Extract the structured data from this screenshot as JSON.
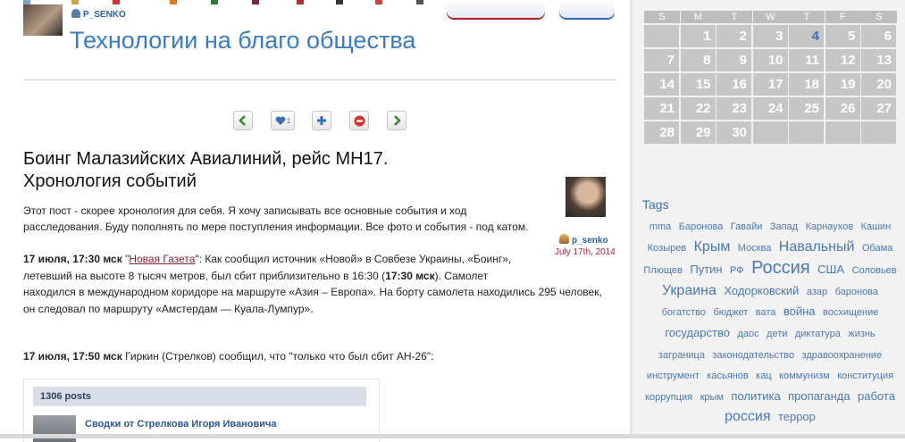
{
  "header": {
    "author": "p_senko",
    "site_title": "Технологии на благо общества"
  },
  "nav": {
    "prev_icon": "chevron-left-icon",
    "like_icon": "heart-icon",
    "like_count": "1",
    "add_icon": "plus-icon",
    "block_icon": "no-entry-icon",
    "next_icon": "chevron-right-icon"
  },
  "post": {
    "title_line1": "Боинг Малазийских Авиалиний, рейс MH17.",
    "title_line2": "Хронология событий",
    "intro_line1": "Этот пост - скорее хронология для себя. Я хочу записывать все основные события и ход",
    "intro_line2": "расследования. Буду пополнять по мере поступления информации. Все фото и события - под катом.",
    "author": "p_senko",
    "date": "July 17th, 2014",
    "entry1": {
      "time": "17 июля, 17:30 мск",
      "q_open": " \"",
      "source": "Новая Газета",
      "line1_rest": "\": Как сообщил источник «Новой» в Совбезе Украины, «Боинг»,",
      "line2_pre": "летевший на высоте 8 тысяч метров, был сбит приблизительно в 16:30 (",
      "line2_bold": "17:30 мск",
      "line2_post": "). Самолет",
      "line3": "находился в международном коридоре на маршруте «Азия – Европа». На борту самолета находились 295 человек,",
      "line4": "он следовал по маршруту «Амстердам — Куала-Лумпур»."
    },
    "entry2": {
      "time": "17 июля, 17:50 мск",
      "text": " Гиркин (Стрелков) сообщил, что \"только что был сбит АН-26\":"
    },
    "embed": {
      "posts": "1306 posts",
      "link": "Сводки от Стрелкова Игоря Ивановича"
    }
  },
  "calendar": {
    "weekdays": [
      "S",
      "M",
      "T",
      "W",
      "T",
      "F",
      "S"
    ],
    "weeks": [
      [
        "",
        "1",
        "2",
        "3",
        "4",
        "5",
        "6"
      ],
      [
        "7",
        "8",
        "9",
        "10",
        "11",
        "12",
        "13"
      ],
      [
        "14",
        "15",
        "16",
        "17",
        "18",
        "19",
        "20"
      ],
      [
        "21",
        "22",
        "23",
        "24",
        "25",
        "26",
        "27"
      ],
      [
        "28",
        "29",
        "30",
        "",
        "",
        "",
        ""
      ]
    ],
    "highlighted": "4"
  },
  "tags": {
    "title": "Tags",
    "items": [
      {
        "text": "mma",
        "weight": 1
      },
      {
        "text": "Баронова",
        "weight": 1
      },
      {
        "text": "Гавайи",
        "weight": 1
      },
      {
        "text": "Запад",
        "weight": 1
      },
      {
        "text": "Карнаухов",
        "weight": 1
      },
      {
        "text": "Кашин",
        "weight": 1
      },
      {
        "text": "Козырев",
        "weight": 1
      },
      {
        "text": "Крым",
        "weight": 3
      },
      {
        "text": "Москва",
        "weight": 1
      },
      {
        "text": "Навальный",
        "weight": 3
      },
      {
        "text": "Обама",
        "weight": 1
      },
      {
        "text": "Плющев",
        "weight": 1
      },
      {
        "text": "Путин",
        "weight": 2
      },
      {
        "text": "РФ",
        "weight": 1
      },
      {
        "text": "Россия",
        "weight": 4
      },
      {
        "text": "США",
        "weight": 2
      },
      {
        "text": "Соловьев",
        "weight": 1
      },
      {
        "text": "Украина",
        "weight": 3
      },
      {
        "text": "Ходорковский",
        "weight": 2
      },
      {
        "text": "азар",
        "weight": 1
      },
      {
        "text": "баронова",
        "weight": 1
      },
      {
        "text": "богатство",
        "weight": 1
      },
      {
        "text": "бюджет",
        "weight": 1
      },
      {
        "text": "вата",
        "weight": 1
      },
      {
        "text": "война",
        "weight": 2
      },
      {
        "text": "восхищение",
        "weight": 1
      },
      {
        "text": "государство",
        "weight": 2
      },
      {
        "text": "даос",
        "weight": 1
      },
      {
        "text": "дети",
        "weight": 1
      },
      {
        "text": "диктатура",
        "weight": 1
      },
      {
        "text": "жизнь",
        "weight": 1
      },
      {
        "text": "заграница",
        "weight": 1
      },
      {
        "text": "законодательство",
        "weight": 1
      },
      {
        "text": "здравоохранение",
        "weight": 1
      },
      {
        "text": "инструмент",
        "weight": 1
      },
      {
        "text": "касьянов",
        "weight": 1
      },
      {
        "text": "кац",
        "weight": 1
      },
      {
        "text": "коммунизм",
        "weight": 1
      },
      {
        "text": "конституция",
        "weight": 1
      },
      {
        "text": "коррупция",
        "weight": 1
      },
      {
        "text": "крым",
        "weight": 1
      },
      {
        "text": "политика",
        "weight": 2
      },
      {
        "text": "пропаганда",
        "weight": 2
      },
      {
        "text": "работа",
        "weight": 2
      },
      {
        "text": "россия",
        "weight": 3
      },
      {
        "text": "террор",
        "weight": 2
      }
    ]
  },
  "colors": {
    "link_blue": "#3a7bc6",
    "tag_blue": "#4a78b0",
    "calendar_cell": "#c6c6c6",
    "date_red": "#a02a3a"
  }
}
